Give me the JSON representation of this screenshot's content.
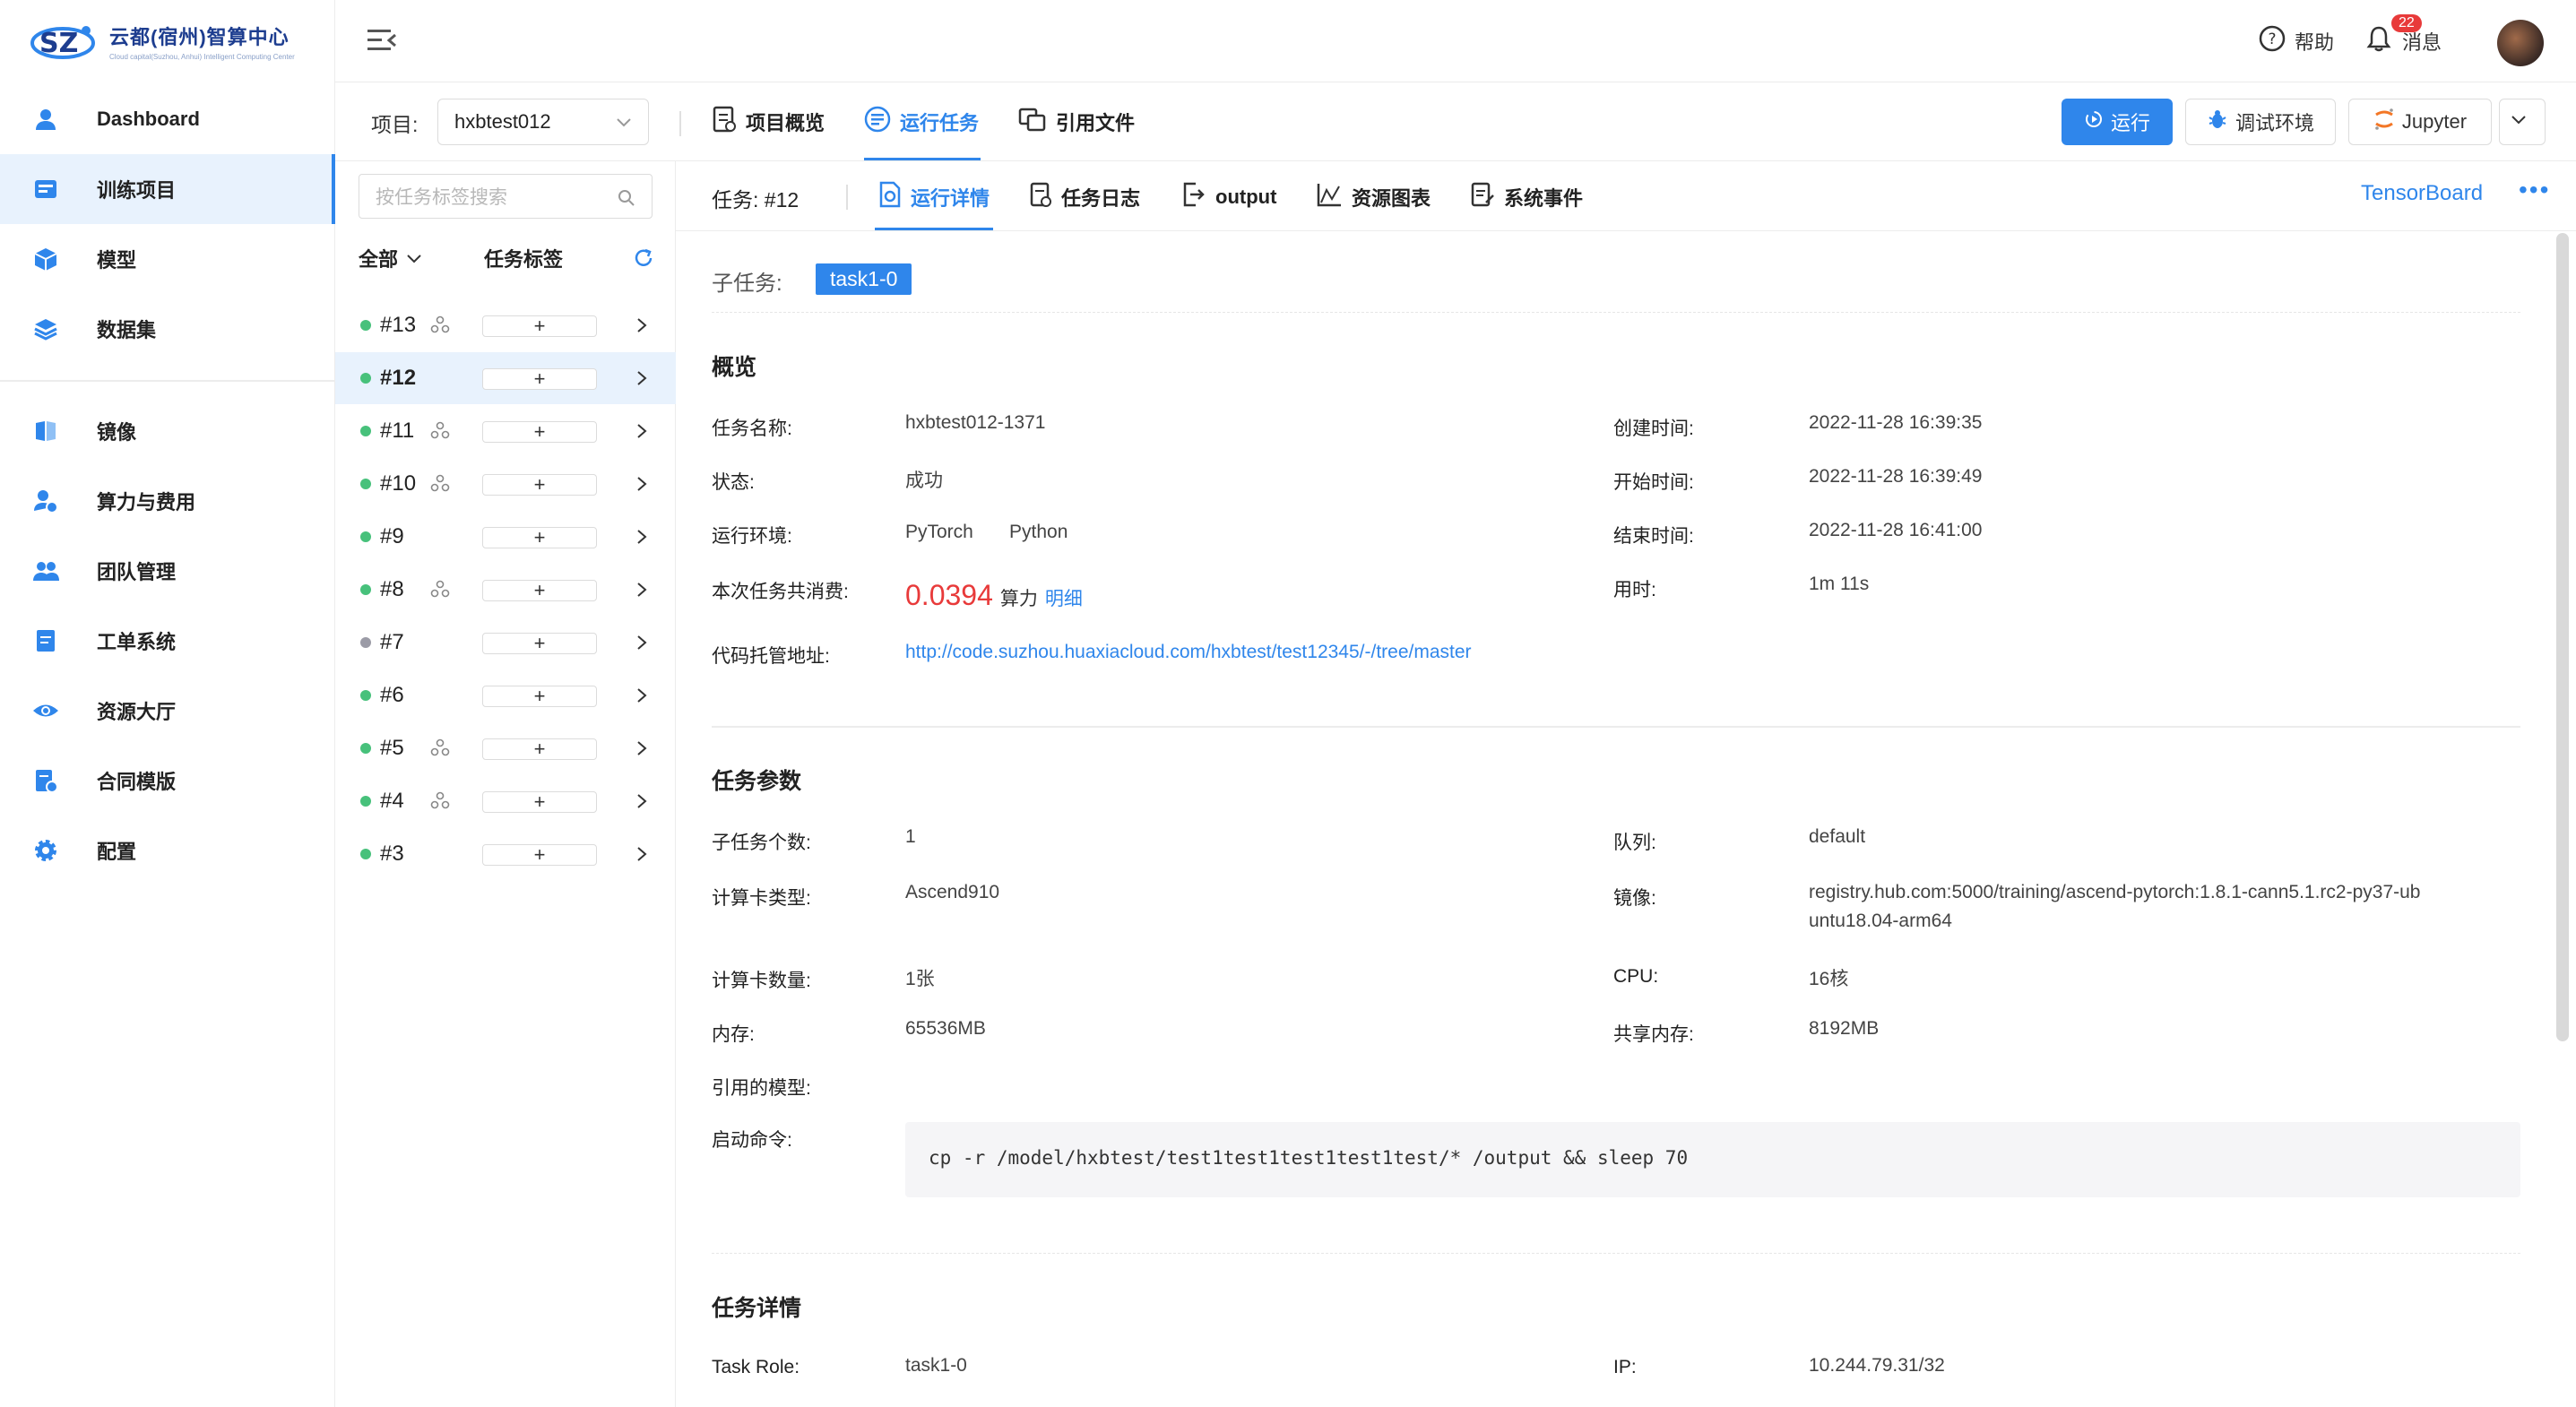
{
  "app": {
    "logo_title": "云都(宿州)智算中心",
    "logo_subtitle": "Cloud capital(Suzhou, Anhui) Intelligent Computing Center"
  },
  "sidebar": {
    "items": [
      {
        "label": "Dashboard",
        "icon": "user-icon"
      },
      {
        "label": "训练项目",
        "icon": "training-icon"
      },
      {
        "label": "模型",
        "icon": "cube-icon"
      },
      {
        "label": "数据集",
        "icon": "layers-icon"
      },
      {
        "label": "镜像",
        "icon": "book-icon"
      },
      {
        "label": "算力与费用",
        "icon": "billing-icon"
      },
      {
        "label": "团队管理",
        "icon": "team-icon"
      },
      {
        "label": "工单系统",
        "icon": "ticket-icon"
      },
      {
        "label": "资源大厅",
        "icon": "eye-icon"
      },
      {
        "label": "合同模版",
        "icon": "contract-icon"
      },
      {
        "label": "配置",
        "icon": "gear-icon"
      }
    ],
    "active_index": 1
  },
  "header": {
    "help": "帮助",
    "messages": "消息",
    "message_count": "22"
  },
  "project_bar": {
    "label": "项目:",
    "selected_project": "hxbtest012",
    "tabs": [
      "项目概览",
      "运行任务",
      "引用文件"
    ],
    "active_tab": 1,
    "buttons": {
      "run": "运行",
      "debug": "调试环境",
      "jupyter": "Jupyter"
    }
  },
  "task_list": {
    "search_placeholder": "按任务标签搜索",
    "filter_label": "全部",
    "tag_header": "任务标签",
    "add_tag_symbol": "+",
    "tasks": [
      {
        "id": "#13",
        "status": "success",
        "distributed": true
      },
      {
        "id": "#12",
        "status": "success",
        "distributed": false,
        "selected": true
      },
      {
        "id": "#11",
        "status": "success",
        "distributed": true
      },
      {
        "id": "#10",
        "status": "success",
        "distributed": true
      },
      {
        "id": "#9",
        "status": "success",
        "distributed": false
      },
      {
        "id": "#8",
        "status": "success",
        "distributed": true
      },
      {
        "id": "#7",
        "status": "stopped",
        "distributed": false
      },
      {
        "id": "#6",
        "status": "success",
        "distributed": false
      },
      {
        "id": "#5",
        "status": "success",
        "distributed": true
      },
      {
        "id": "#4",
        "status": "success",
        "distributed": true
      },
      {
        "id": "#3",
        "status": "success",
        "distributed": false
      }
    ]
  },
  "detail": {
    "task_label": "任务: #12",
    "tabs": [
      "运行详情",
      "任务日志",
      "output",
      "资源图表",
      "系统事件"
    ],
    "active_tab": 0,
    "tensorboard": "TensorBoard",
    "subtask_label": "子任务:",
    "subtask_value": "task1-0",
    "overview": {
      "title": "概览",
      "task_name_k": "任务名称:",
      "task_name_v": "hxbtest012-1371",
      "status_k": "状态:",
      "status_v": "成功",
      "env_k": "运行环境:",
      "env_v1": "PyTorch",
      "env_v2": "Python",
      "cost_k": "本次任务共消费:",
      "cost_v": "0.0394",
      "cost_unit": "算力",
      "cost_detail": "明细",
      "repo_k": "代码托管地址:",
      "repo_v": "http://code.suzhou.huaxiacloud.com/hxbtest/test12345/-/tree/master",
      "created_k": "创建时间:",
      "created_v": "2022-11-28 16:39:35",
      "start_k": "开始时间:",
      "start_v": "2022-11-28 16:39:49",
      "end_k": "结束时间:",
      "end_v": "2022-11-28 16:41:00",
      "duration_k": "用时:",
      "duration_v": "1m 11s"
    },
    "params": {
      "title": "任务参数",
      "subtasks_k": "子任务个数:",
      "subtasks_v": "1",
      "card_type_k": "计算卡类型:",
      "card_type_v": "Ascend910",
      "card_count_k": "计算卡数量:",
      "card_count_v": "1张",
      "memory_k": "内存:",
      "memory_v": "65536MB",
      "model_k": "引用的模型:",
      "command_k": "启动命令:",
      "command_v": "cp -r /model/hxbtest/test1test1test1test1test/* /output && sleep 70",
      "queue_k": "队列:",
      "queue_v": "default",
      "image_k": "镜像:",
      "image_v1": "registry.hub.com:5000/training/ascend-pytorch:1.8.1-cann5.1.rc2-py37-ub",
      "image_v2": "untu18.04-arm64",
      "cpu_k": "CPU:",
      "cpu_v": "16核",
      "shm_k": "共享内存:",
      "shm_v": "8192MB"
    },
    "task_detail": {
      "title": "任务详情",
      "role_k": "Task Role:",
      "role_v": "task1-0",
      "ip_k": "IP:",
      "ip_v": "10.244.79.31/32"
    }
  }
}
